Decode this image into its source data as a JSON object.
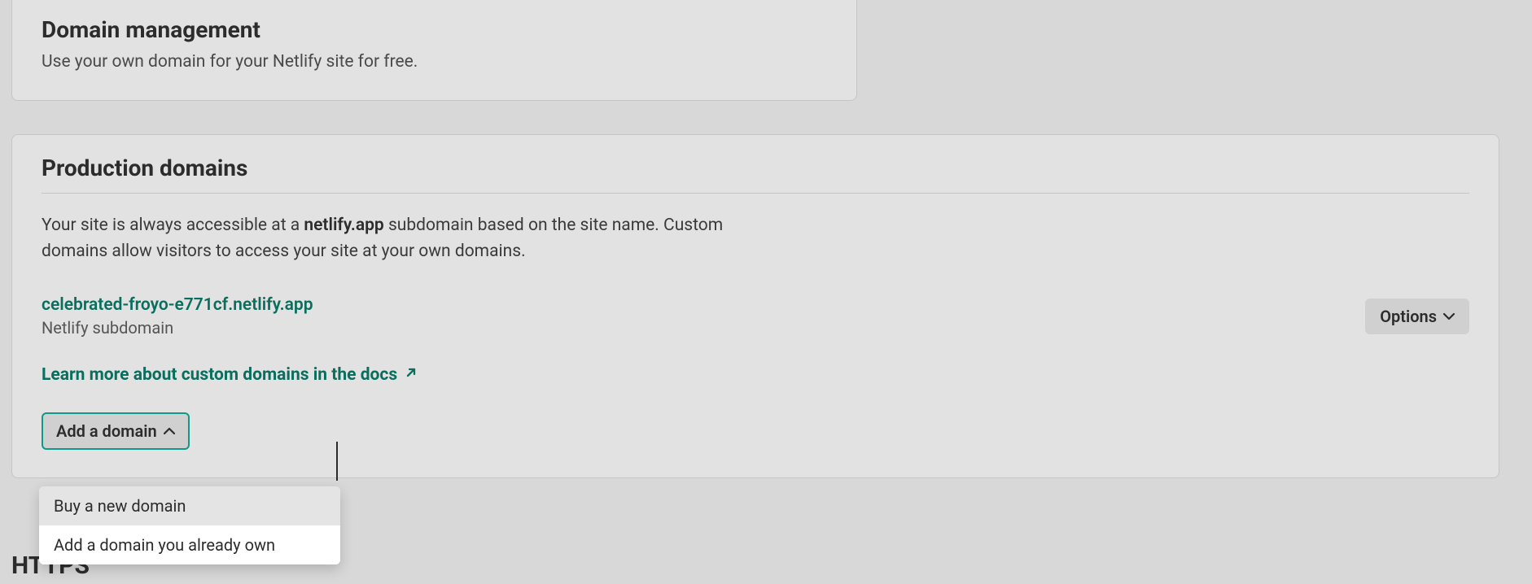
{
  "domain_mgmt": {
    "title": "Domain management",
    "desc": "Use your own domain for your Netlify site for free."
  },
  "production": {
    "title": "Production domains",
    "desc_pre": "Your site is always accessible at a ",
    "desc_bold": "netlify.app",
    "desc_post": " subdomain based on the site name. Custom domains allow visitors to access your site at your own domains.",
    "domain_url": "celebrated-froyo-e771cf.netlify.app",
    "domain_type": "Netlify subdomain",
    "options_label": "Options",
    "learn_link": "Learn more about custom domains in the docs",
    "add_domain_label": "Add a domain",
    "dropdown": {
      "buy": "Buy a new domain",
      "own": "Add a domain you already own"
    }
  },
  "https": {
    "title": "HTTPS"
  }
}
